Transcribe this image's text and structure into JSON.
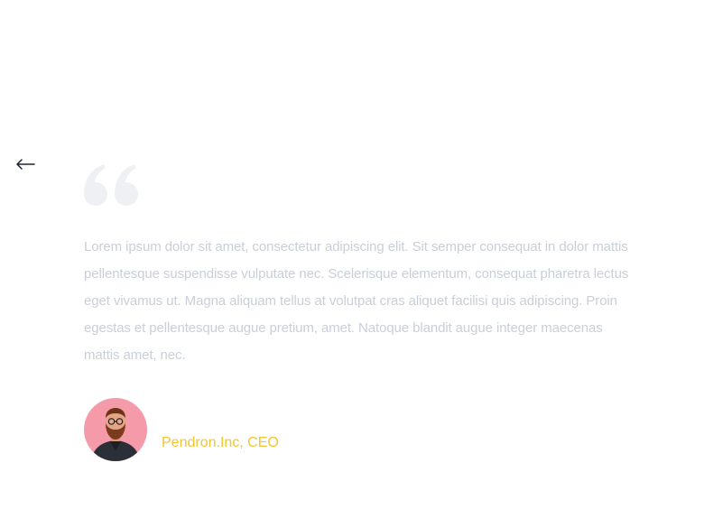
{
  "testimonial": {
    "quote": "Lorem ipsum dolor sit amet, consectetur adipiscing elit. Sit semper consequat in dolor mattis pellentesque suspendisse vulputate nec. Scelerisque elementum, consequat pharetra lectus eget vivamus ut. Magna aliquam tellus at volutpat cras aliquet facilisi quis adipiscing. Proin egestas et pellentesque augue pretium, amet. Natoque blandit augue integer maecenas mattis amet, nec.",
    "author": "Pendron.Inc, CEO"
  },
  "icons": {
    "prev": "arrow-left-icon",
    "quote": "quote-mark-icon"
  },
  "colors": {
    "quote_text": "#c9cfd9",
    "quote_mark": "#eef0f3",
    "author_name": "#f4c430",
    "avatar_bg": "#f59aa9"
  }
}
